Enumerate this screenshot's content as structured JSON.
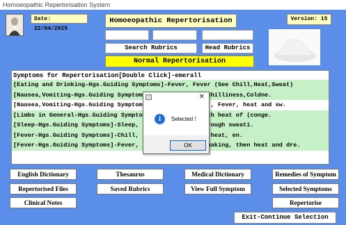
{
  "window": {
    "title": "Homoeopathic Repertorisation System"
  },
  "header": {
    "date": "Date: 22/04/2025",
    "app_title": "Homoeopathic Repertorisation",
    "version": "Version: 15"
  },
  "search": {
    "search_rubrics_label": "Search Rubrics",
    "head_rubrics_label": "Head Rubrics",
    "normal_repertorisation_label": "Normal Repertorisation"
  },
  "symptoms": {
    "header": "Symptoms for Repertorisation[Double Click]-emerall",
    "rows": [
      "[Eating and Drinking-Hgs.Guiding Symptoms]-Fever, Fever (See Chill,Heat,Sweat)",
      "[Nausea,Vomiting-Hgs.Guiding Symptoms]-Fever, in (See Chilliness,Coldne.",
      "[Nausea,Vomiting-Hgs.Guiding Symptoms]-Fever, Bile, of , Fever, heat and sw.",
      "[Limbs in General-Hgs.Guiding Symptoms]-Heat, Face, with heat of (conge.",
      "[Sleep-Hgs.Guiding Symptoms]-Sleep, continues from, through sweati.",
      "[Fever-Hgs.Guiding Symptoms]-Chill, 7th day, chill and heat, en.",
      "[Fever-Hgs.Guiding Symptoms]-Fever, Hectic , chills, shaking, then heat and dre."
    ]
  },
  "buttons": {
    "english_dictionary": "English Dictionary",
    "thesaurus": "Thesaurus",
    "medical_dictionary": "Medical Dictionary",
    "remedies_of_symptom": "Remedies of Symptom",
    "repertorised_files": "Repertorised Files",
    "saved_rubrics": "Saved Rubrics",
    "view_full_symptom": "View Full Symptom",
    "selected_symptoms": "Selected Symptoms",
    "clinical_notes": "Clinical Notes",
    "repertorise": "Repertorise",
    "exit_continue": "Exit-Continue Selection"
  },
  "dialog": {
    "message": "Selected !",
    "ok_label": "OK",
    "close_glyph": "✕",
    "info_glyph": "i"
  },
  "icons": {
    "avatar": "portrait-image",
    "powder": "white-powder-image",
    "info": "info-icon"
  },
  "colors": {
    "background": "#5b8ee8",
    "label_yellow": "#ffffc0",
    "highlight_yellow": "#ffff00",
    "row_green": "#c6f0c6"
  }
}
